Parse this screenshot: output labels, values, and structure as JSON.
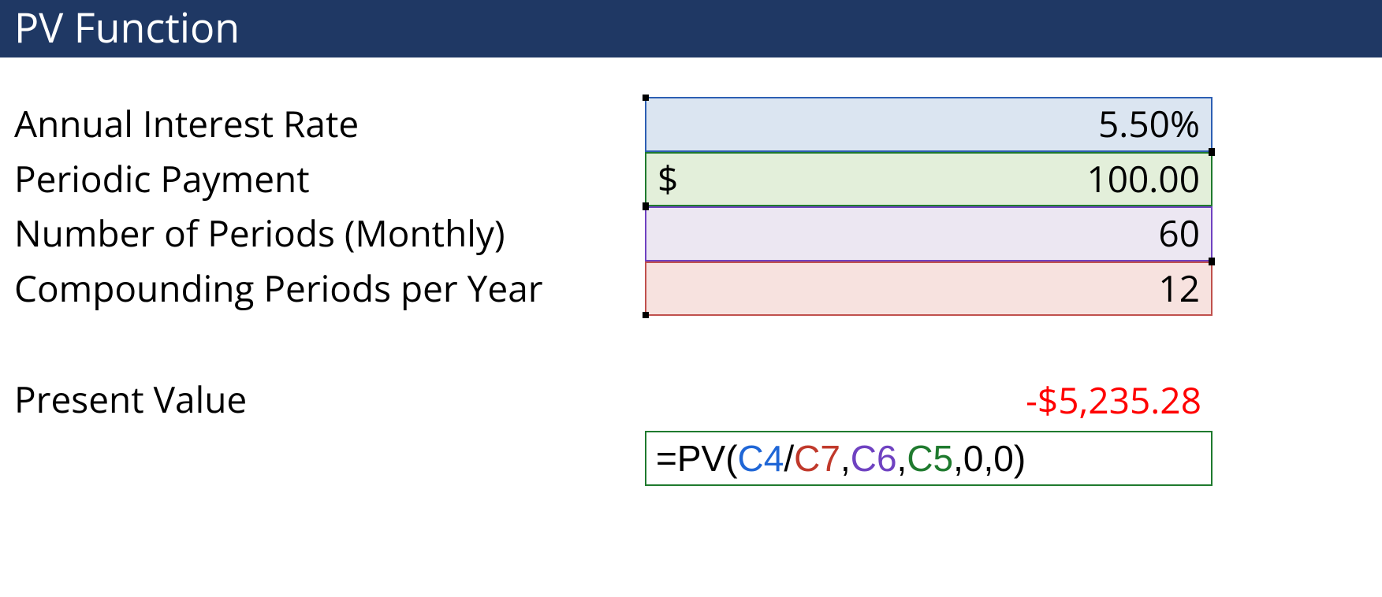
{
  "header": {
    "title": "PV Function"
  },
  "rows": {
    "rate": {
      "label": "Annual Interest Rate",
      "value": "5.50%"
    },
    "pmt": {
      "label": "Periodic Payment",
      "currency": "$",
      "value": "100.00"
    },
    "nper": {
      "label": "Number of Periods (Monthly)",
      "value": "60"
    },
    "comp": {
      "label": "Compounding Periods per Year",
      "value": "12"
    }
  },
  "result": {
    "label": "Present Value",
    "value": "-$5,235.28"
  },
  "formula": {
    "prefix": "=PV(",
    "c4": "C4",
    "slash": "/",
    "c7": "C7",
    "comma1": ",",
    "c6": "C6",
    "comma2": ",",
    "c5": "C5",
    "tail": ",0,0)"
  }
}
